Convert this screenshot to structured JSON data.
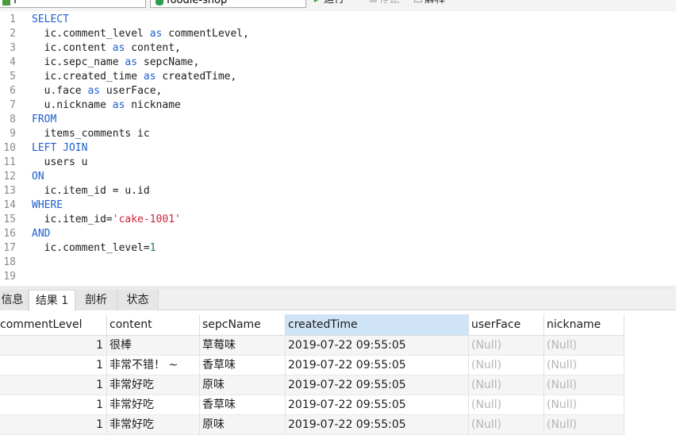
{
  "toolbar": {
    "connection_value": "f",
    "database_value": "foodie-shop",
    "run_label": "运行",
    "stop_label": "停止",
    "explain_label": "解释"
  },
  "editor": {
    "line_numbers": [
      "1",
      "2",
      "3",
      "4",
      "5",
      "6",
      "7",
      "8",
      "9",
      "10",
      "11",
      "12",
      "13",
      "14",
      "15",
      "16",
      "17",
      "18",
      "19"
    ],
    "lines": [
      [
        {
          "t": "kw",
          "v": "SELECT"
        }
      ],
      [
        {
          "t": "id",
          "v": "  ic.comment_level "
        },
        {
          "t": "kw",
          "v": "as"
        },
        {
          "t": "id",
          "v": " commentLevel,"
        }
      ],
      [
        {
          "t": "id",
          "v": "  ic.content "
        },
        {
          "t": "kw",
          "v": "as"
        },
        {
          "t": "id",
          "v": " content,"
        }
      ],
      [
        {
          "t": "id",
          "v": "  ic.sepc_name "
        },
        {
          "t": "kw",
          "v": "as"
        },
        {
          "t": "id",
          "v": " sepcName,"
        }
      ],
      [
        {
          "t": "id",
          "v": "  ic.created_time "
        },
        {
          "t": "kw",
          "v": "as"
        },
        {
          "t": "id",
          "v": " createdTime,"
        }
      ],
      [
        {
          "t": "id",
          "v": "  u.face "
        },
        {
          "t": "kw",
          "v": "as"
        },
        {
          "t": "id",
          "v": " userFace,"
        }
      ],
      [
        {
          "t": "id",
          "v": "  u.nickname "
        },
        {
          "t": "kw",
          "v": "as"
        },
        {
          "t": "id",
          "v": " nickname"
        }
      ],
      [
        {
          "t": "kw",
          "v": "FROM"
        }
      ],
      [
        {
          "t": "id",
          "v": "  items_comments ic"
        }
      ],
      [
        {
          "t": "kw",
          "v": "LEFT JOIN"
        }
      ],
      [
        {
          "t": "id",
          "v": "  users u"
        }
      ],
      [
        {
          "t": "kw",
          "v": "ON"
        }
      ],
      [
        {
          "t": "id",
          "v": "  ic.item_id = u.id"
        }
      ],
      [
        {
          "t": "kw",
          "v": "WHERE"
        }
      ],
      [
        {
          "t": "id",
          "v": "  ic.item_id="
        },
        {
          "t": "str",
          "v": "'cake-1001'"
        }
      ],
      [
        {
          "t": "kw",
          "v": "AND"
        }
      ],
      [
        {
          "t": "id",
          "v": "  ic.comment_level="
        },
        {
          "t": "num",
          "v": "1"
        }
      ],
      [],
      []
    ]
  },
  "result_tabs": [
    "信息",
    "结果 1",
    "剖析",
    "状态"
  ],
  "active_tab": "结果 1",
  "table": {
    "columns": [
      "commentLevel",
      "content",
      "sepcName",
      "createdTime",
      "userFace",
      "nickname"
    ],
    "selected_column": "createdTime",
    "rows": [
      [
        "1",
        "很棒",
        "草莓味",
        "2019-07-22 09:55:05",
        "(Null)",
        "(Null)"
      ],
      [
        "1",
        "非常不错！ ~",
        "香草味",
        "2019-07-22 09:55:05",
        "(Null)",
        "(Null)"
      ],
      [
        "1",
        "非常好吃",
        "原味",
        "2019-07-22 09:55:05",
        "(Null)",
        "(Null)"
      ],
      [
        "1",
        "非常好吃",
        "香草味",
        "2019-07-22 09:55:05",
        "(Null)",
        "(Null)"
      ],
      [
        "1",
        "非常好吃",
        "原味",
        "2019-07-22 09:55:05",
        "(Null)",
        "(Null)"
      ]
    ]
  }
}
